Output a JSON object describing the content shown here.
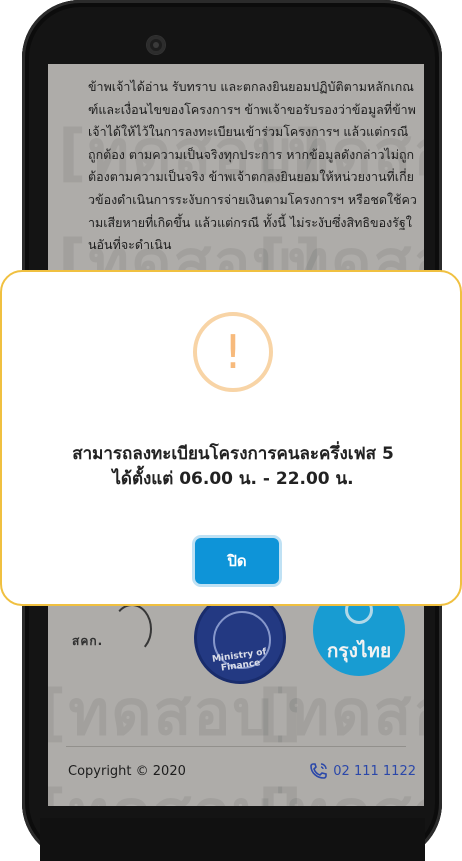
{
  "terms": {
    "text": "ข้าพเจ้าได้อ่าน รับทราบ และตกลงยินยอมปฏิบัติตามหลักเกณฑ์และเงื่อนไขของโครงการฯ ข้าพเจ้าขอรับรองว่าข้อมูลที่ข้าพเจ้าได้ให้ไว้ในการลงทะเบียนเข้าร่วมโครงการฯ แล้วแต่กรณี ถูกต้อง ตามความเป็นจริงทุกประการ หากข้อมูลดังกล่าวไม่ถูกต้องตามความเป็นจริง ข้าพเจ้าตกลงยินยอมให้หน่วยงานที่เกี่ยวข้องดำเนินการระงับการจ่ายเงินตามโครงการฯ หรือชดใช้ความเสียหายที่เกิดขึ้น แล้วแต่กรณี ทั้งนี้ ไม่ระงับซึ่งสิทธิของรัฐในอันที่จะดำเนิน"
  },
  "watermark": "[ทดสอบ]",
  "logos": {
    "sdk": "สคก.",
    "mof": "Ministry of Finance",
    "ktb": "กรุงไทย"
  },
  "footer": {
    "copyright": "Copyright © 2020",
    "phone": "02 111 1122"
  },
  "dialog": {
    "icon": "warning-exclamation-icon",
    "icon_color": "#f7ba7c",
    "message_line1": "สามารถลงทะเบียนโครงการคนละครึ่งเฟส 5",
    "message_line2": "ได้ตั้งแต่ 06.00 น. - 22.00 น.",
    "close_label": "ปิด",
    "button_color": "#0e94d8",
    "border_color": "#f0c040"
  }
}
